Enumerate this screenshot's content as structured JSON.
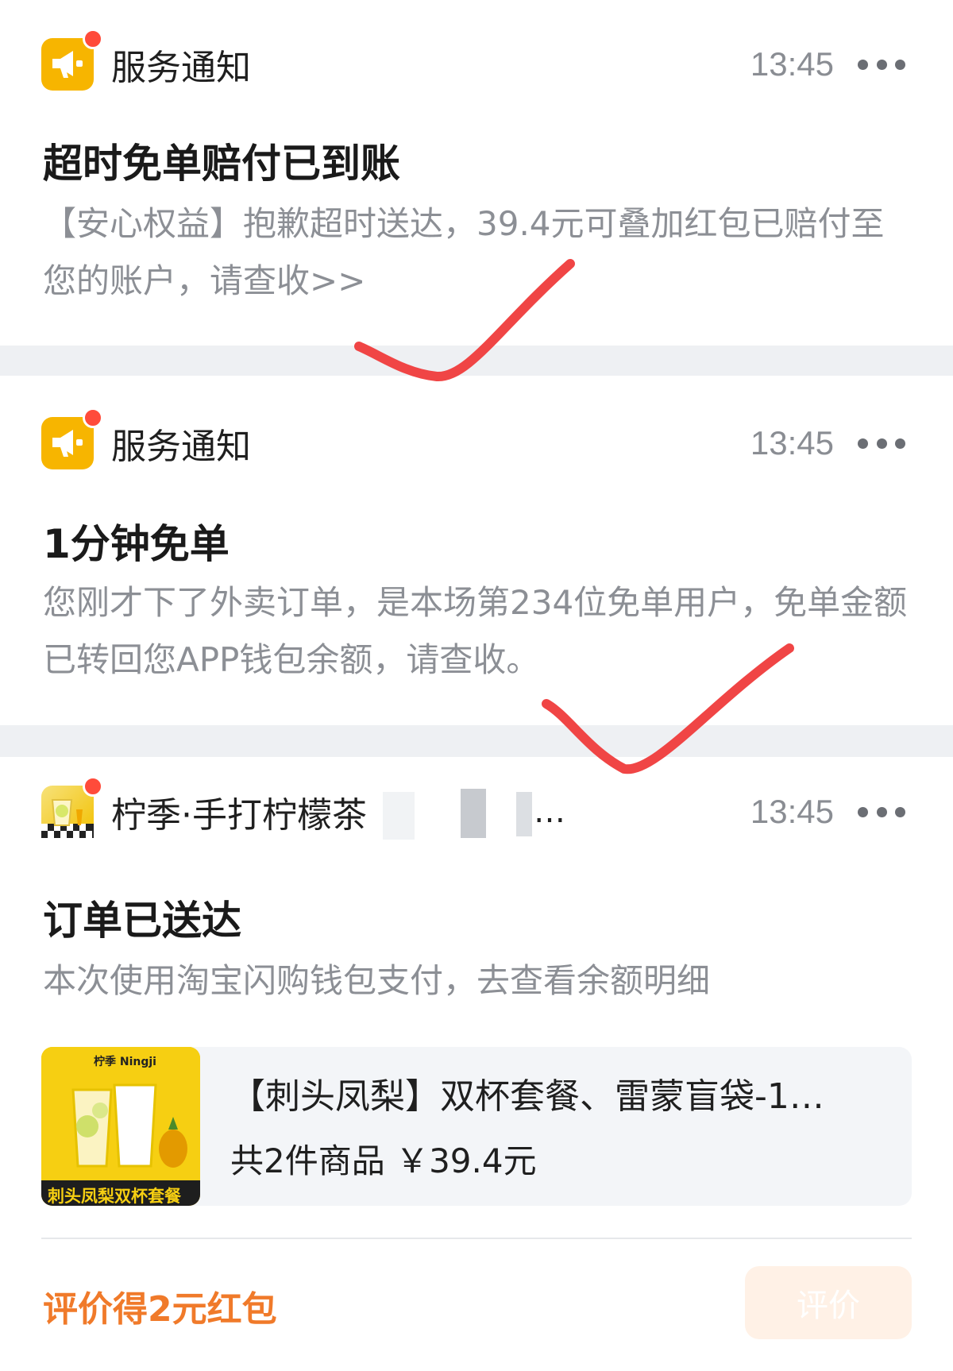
{
  "notifications": [
    {
      "sender": "服务通知",
      "time": "13:45",
      "title": "超时免单赔付已到账",
      "body": "【安心权益】抱歉超时送达，39.4元可叠加红包已赔付至您的账户，请查收>>"
    },
    {
      "sender": "服务通知",
      "time": "13:45",
      "title": "1分钟免单",
      "body": "您刚才下了外卖订单，是本场第234位免单用户，免单金额已转回您APP钱包余额，请查收。"
    },
    {
      "sender": "柠季·手打柠檬茶",
      "sender_suffix": "…",
      "time": "13:45",
      "title": "订单已送达",
      "body": "本次使用淘宝闪购钱包支付，去查看余额明细"
    }
  ],
  "product": {
    "name": "【刺头凤梨】双杯套餐、雷蒙盲袋-1…",
    "summary": "共2件商品  ￥39.4元",
    "image_brand": "柠季 Ningji",
    "image_caption": "刺头凤梨双杯套餐"
  },
  "footer": {
    "promo": "评价得2元红包",
    "review_button": "评价"
  },
  "colors": {
    "service_icon": "#f7b500",
    "badge": "#ff4b3a",
    "checkmark": "#f04545",
    "promo": "#f07a2a"
  }
}
